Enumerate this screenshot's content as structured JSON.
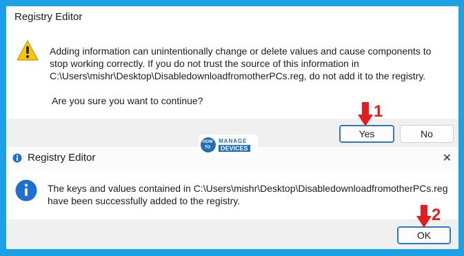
{
  "dialog1": {
    "title": "Registry Editor",
    "message_line1": "Adding information can unintentionally change or delete values and cause components to",
    "message_line2": "stop working correctly. If you do not trust the source of this information in",
    "message_line3": "C:\\Users\\mishr\\Desktop\\DisabledownloadfromotherPCs.reg, do not add it to the registry.",
    "question": "Are you sure you want to continue?",
    "yes_label": "Yes",
    "no_label": "No",
    "icon": "warning-icon"
  },
  "dialog2": {
    "title": "Registry Editor",
    "message_line1": "The keys and values contained in C:\\Users\\mishr\\Desktop\\DisabledownloadfromotherPCs.reg",
    "message_line2": "have been successfully added to the registry.",
    "ok_label": "OK",
    "close_glyph": "✕",
    "icon": "info-icon",
    "title_icon": "info-icon"
  },
  "watermark": {
    "line_how": "HOW",
    "line_to": "TO",
    "line_manage": "MANAGE",
    "line_devices": "DEVICES"
  },
  "annotations": {
    "step1": "1",
    "step2": "2",
    "color": "#e21d1d"
  },
  "colors": {
    "background": "#1da1e6",
    "accent": "#2f77c9",
    "info": "#1e6fd0",
    "warning": "#f5c311"
  }
}
